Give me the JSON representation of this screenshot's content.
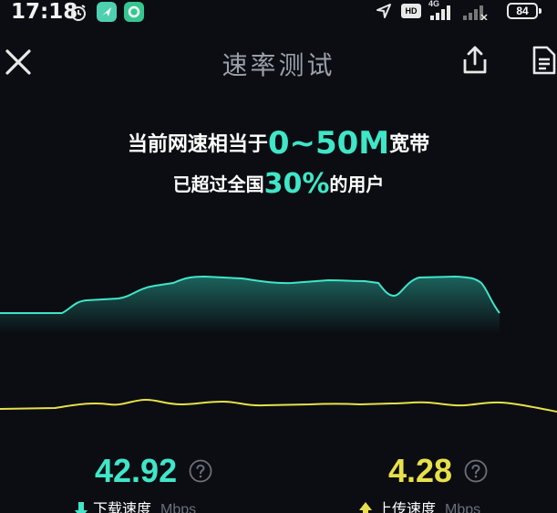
{
  "status_bar": {
    "time": "17:18",
    "network": "4G",
    "hd": "HD",
    "battery": "84"
  },
  "header": {
    "title": "速率测试"
  },
  "result": {
    "line1_prefix": "当前网速相当于",
    "line1_highlight": "0~50M",
    "line1_suffix": "宽带",
    "line2_prefix": "已超过全国",
    "line2_highlight": "30%",
    "line2_suffix": "的用户"
  },
  "download": {
    "value": "42.92",
    "label": "下载速度",
    "unit": "Mbps"
  },
  "upload": {
    "value": "4.28",
    "label": "上传速度",
    "unit": "Mbps"
  },
  "colors": {
    "download": "#3fe6c8",
    "upload": "#e8e04a",
    "background": "#0b0d12"
  },
  "icons": [
    "alarm-icon",
    "app-icon",
    "location-icon",
    "signal-icon",
    "battery-icon",
    "close-icon",
    "share-icon",
    "document-icon",
    "help-icon",
    "arrow-down-icon",
    "arrow-up-icon"
  ]
}
